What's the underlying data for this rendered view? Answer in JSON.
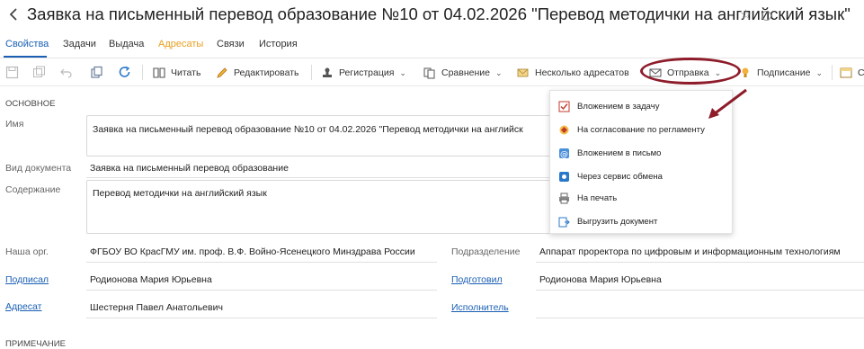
{
  "header": {
    "title": "Заявка на письменный перевод образование №10 от 04.02.2026 \"Перевод методички на английский язык\""
  },
  "tabs": [
    {
      "label": "Свойства"
    },
    {
      "label": "Задачи"
    },
    {
      "label": "Выдача"
    },
    {
      "label": "Адресаты"
    },
    {
      "label": "Связи"
    },
    {
      "label": "История"
    }
  ],
  "toolbar": {
    "read": "Читать",
    "edit": "Редактировать",
    "registration": "Регистрация",
    "compare": "Сравнение",
    "multi": "Несколько адресатов",
    "send": "Отправка",
    "sign": "Подписание",
    "more": "С"
  },
  "send_menu": {
    "items": [
      {
        "label": "Вложением в задачу",
        "icon": "task-attach-icon"
      },
      {
        "label": "На согласование по регламенту",
        "icon": "approval-route-icon"
      },
      {
        "label": "Вложением в письмо",
        "icon": "email-attach-icon"
      },
      {
        "label": "Через сервис обмена",
        "icon": "exchange-service-icon"
      },
      {
        "label": "На печать",
        "icon": "print-icon"
      },
      {
        "label": "Выгрузить документ",
        "icon": "export-document-icon"
      }
    ]
  },
  "form": {
    "section_main": "ОСНОВНОЕ",
    "name_label": "Имя",
    "name_value": "Заявка на письменный перевод образование №10 от 04.02.2026 \"Перевод методички на английск",
    "doctype_label": "Вид документа",
    "doctype_value": "Заявка на письменный перевод образование",
    "content_label": "Содержание",
    "content_value": "Перевод методички на английский язык",
    "org_label": "Наша орг.",
    "org_value": "ФГБОУ ВО КрасГМУ им. проф. В.Ф. Войно-Ясенецкого Минздрава России",
    "dept_label": "Подразделение",
    "dept_value": "Аппарат проректора по цифровым и информационным технологиям",
    "signed_label": "Подписал",
    "signed_value": "Родионова Мария Юрьевна",
    "prepared_label": "Подготовил",
    "prepared_value": "Родионова Мария Юрьевна",
    "addressee_label": "Адресат",
    "addressee_value": "Шестерня Павел Анатольевич",
    "executor_label": "Исполнитель",
    "section_note": "ПРИМЕЧАНИЕ"
  },
  "colors": {
    "accent_blue": "#1a5fb4",
    "tab_highlight": "#e8a020",
    "annotation": "#8e1c2a"
  }
}
